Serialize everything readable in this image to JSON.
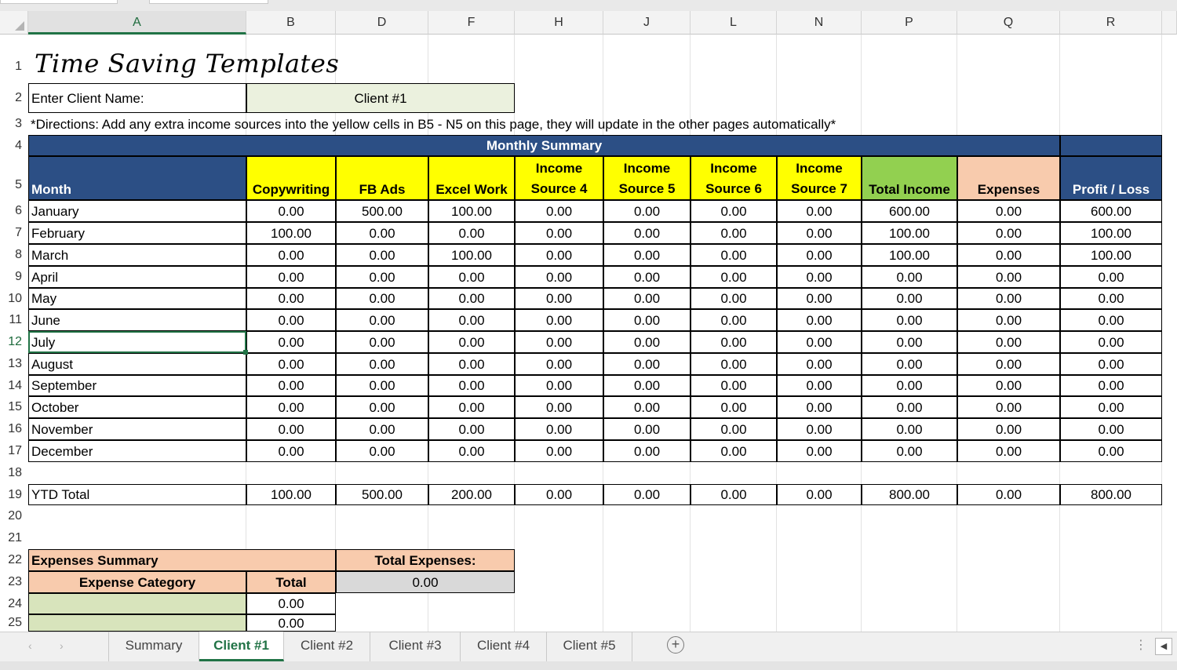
{
  "columns": [
    "A",
    "B",
    "D",
    "F",
    "H",
    "J",
    "L",
    "N",
    "P",
    "Q",
    "R"
  ],
  "rows": [
    "1",
    "2",
    "3",
    "4",
    "5",
    "6",
    "7",
    "8",
    "9",
    "10",
    "11",
    "12",
    "13",
    "14",
    "15",
    "16",
    "17",
    "18",
    "19",
    "20",
    "21",
    "22",
    "23",
    "24",
    "25"
  ],
  "title": "Time Saving Templates",
  "client": {
    "label": "Enter Client Name:",
    "value": "Client #1"
  },
  "directions": "*Directions: Add any extra income sources into the yellow cells in B5 - N5 on this page, they will update in the other pages automatically*",
  "summary": {
    "title": "Monthly Summary",
    "headers": {
      "month": "Month",
      "copywriting": "Copywriting",
      "fb_ads": "FB Ads",
      "excel_work": "Excel Work",
      "income_top": "Income",
      "src4": "Source 4",
      "src5": "Source 5",
      "src6": "Source 6",
      "src7": "Source 7",
      "total_income": "Total Income",
      "expenses": "Expenses",
      "profit_loss": "Profit / Loss"
    },
    "months": [
      {
        "name": "January",
        "values": [
          "0.00",
          "500.00",
          "100.00",
          "0.00",
          "0.00",
          "0.00",
          "0.00",
          "600.00",
          "0.00",
          "600.00"
        ]
      },
      {
        "name": "February",
        "values": [
          "100.00",
          "0.00",
          "0.00",
          "0.00",
          "0.00",
          "0.00",
          "0.00",
          "100.00",
          "0.00",
          "100.00"
        ]
      },
      {
        "name": "March",
        "values": [
          "0.00",
          "0.00",
          "100.00",
          "0.00",
          "0.00",
          "0.00",
          "0.00",
          "100.00",
          "0.00",
          "100.00"
        ]
      },
      {
        "name": "April",
        "values": [
          "0.00",
          "0.00",
          "0.00",
          "0.00",
          "0.00",
          "0.00",
          "0.00",
          "0.00",
          "0.00",
          "0.00"
        ]
      },
      {
        "name": "May",
        "values": [
          "0.00",
          "0.00",
          "0.00",
          "0.00",
          "0.00",
          "0.00",
          "0.00",
          "0.00",
          "0.00",
          "0.00"
        ]
      },
      {
        "name": "June",
        "values": [
          "0.00",
          "0.00",
          "0.00",
          "0.00",
          "0.00",
          "0.00",
          "0.00",
          "0.00",
          "0.00",
          "0.00"
        ]
      },
      {
        "name": "July",
        "values": [
          "0.00",
          "0.00",
          "0.00",
          "0.00",
          "0.00",
          "0.00",
          "0.00",
          "0.00",
          "0.00",
          "0.00"
        ]
      },
      {
        "name": "August",
        "values": [
          "0.00",
          "0.00",
          "0.00",
          "0.00",
          "0.00",
          "0.00",
          "0.00",
          "0.00",
          "0.00",
          "0.00"
        ]
      },
      {
        "name": "September",
        "values": [
          "0.00",
          "0.00",
          "0.00",
          "0.00",
          "0.00",
          "0.00",
          "0.00",
          "0.00",
          "0.00",
          "0.00"
        ]
      },
      {
        "name": "October",
        "values": [
          "0.00",
          "0.00",
          "0.00",
          "0.00",
          "0.00",
          "0.00",
          "0.00",
          "0.00",
          "0.00",
          "0.00"
        ]
      },
      {
        "name": "November",
        "values": [
          "0.00",
          "0.00",
          "0.00",
          "0.00",
          "0.00",
          "0.00",
          "0.00",
          "0.00",
          "0.00",
          "0.00"
        ]
      },
      {
        "name": "December",
        "values": [
          "0.00",
          "0.00",
          "0.00",
          "0.00",
          "0.00",
          "0.00",
          "0.00",
          "0.00",
          "0.00",
          "0.00"
        ]
      }
    ],
    "ytd": {
      "name": "YTD Total",
      "values": [
        "100.00",
        "500.00",
        "200.00",
        "0.00",
        "0.00",
        "0.00",
        "0.00",
        "800.00",
        "0.00",
        "800.00"
      ]
    }
  },
  "expenses": {
    "title": "Expenses Summary",
    "total_label": "Total Expenses:",
    "total_value": "0.00",
    "category_header": "Expense Category",
    "total_header": "Total",
    "rows": [
      "0.00",
      "0.00"
    ]
  },
  "tabs": [
    "Summary",
    "Client #1",
    "Client #2",
    "Client #3",
    "Client #4",
    "Client #5"
  ],
  "active_tab": "Client #1",
  "selected_cell": "A12",
  "colors": {
    "header_blue": "#2c4f85",
    "yellow": "#ffff00",
    "green": "#92d050",
    "peach": "#f8cbad",
    "light_green": "#d8e4bc",
    "excel_green": "#217346"
  }
}
